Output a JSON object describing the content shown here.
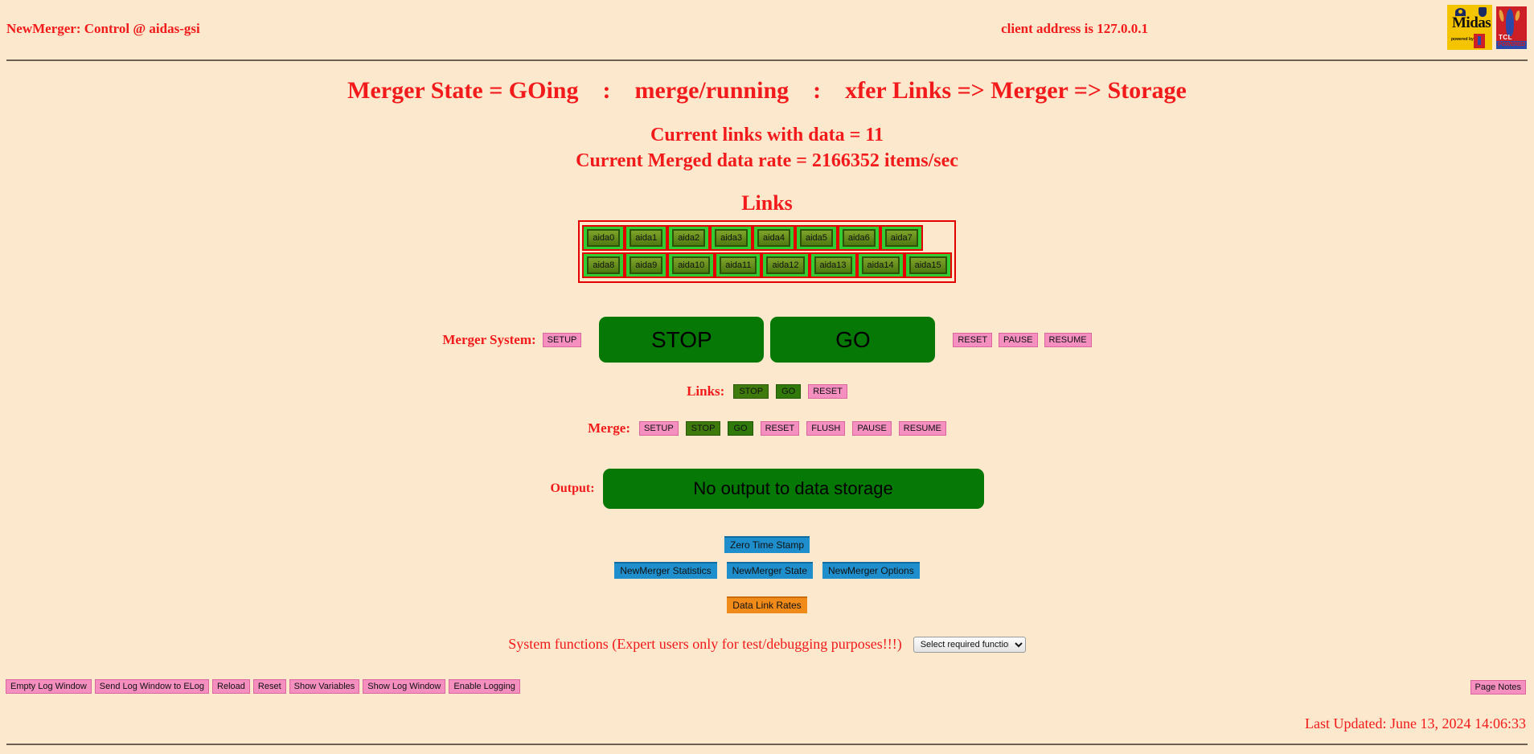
{
  "header": {
    "title": "NewMerger: Control @ aidas-gsi",
    "client_address": "client address is 127.0.0.1",
    "logos": [
      {
        "name": "midas-logo",
        "word": "Midas",
        "sub": "powered by",
        "bg": "#f5c400"
      },
      {
        "name": "tcl-powered-logo",
        "tcl": "TCL",
        "powered": "POWERED",
        "bg": "#cc2026"
      }
    ]
  },
  "status": {
    "merger_state_line": "Merger State = GOing    :    merge/running    :    xfer Links => Merger => Storage",
    "current_links": "Current links with data = 11",
    "current_rate": "Current Merged data rate = 2166352 items/sec"
  },
  "links": {
    "title": "Links",
    "rows": [
      [
        "aida0",
        "aida1",
        "aida2",
        "aida3",
        "aida4",
        "aida5",
        "aida6",
        "aida7"
      ],
      [
        "aida8",
        "aida9",
        "aida10",
        "aida11",
        "aida12",
        "aida13",
        "aida14",
        "aida15"
      ]
    ]
  },
  "merger_system": {
    "label": "Merger System:",
    "setup": "SETUP",
    "stop": "STOP",
    "go": "GO",
    "reset": "RESET",
    "pause": "PAUSE",
    "resume": "RESUME"
  },
  "links_controls": {
    "label": "Links:",
    "stop": "STOP",
    "go": "GO",
    "reset": "RESET"
  },
  "merge_controls": {
    "label": "Merge:",
    "setup": "SETUP",
    "stop": "STOP",
    "go": "GO",
    "reset": "RESET",
    "flush": "FLUSH",
    "pause": "PAUSE",
    "resume": "RESUME"
  },
  "output": {
    "label": "Output:",
    "status": "No output to data storage"
  },
  "info_buttons": {
    "zero_time_stamp": "Zero Time Stamp",
    "statistics": "NewMerger Statistics",
    "state": "NewMerger State",
    "options": "NewMerger Options",
    "data_link_rates": "Data Link Rates"
  },
  "system_functions": {
    "label": "System functions (Expert users only for test/debugging purposes!!!)",
    "selected": "Select required function"
  },
  "bottom": {
    "empty_log_window": "Empty Log Window",
    "send_log_window_to_elog": "Send Log Window to ELog",
    "reload": "Reload",
    "reset": "Reset",
    "show_variables": "Show Variables",
    "show_log_window": "Show Log Window",
    "enable_logging": "Enable Logging",
    "page_notes": "Page Notes",
    "last_updated": "Last Updated: June 13, 2024 14:06:33"
  },
  "colors": {
    "background": "#fbe8cd",
    "red_text": "#f21a1a",
    "green_big": "#067806",
    "pink": "#f48fc0",
    "blue": "#1e8fcc",
    "orange": "#f08a18",
    "link_cell": "#33cc33",
    "link_border": "#e30000"
  }
}
